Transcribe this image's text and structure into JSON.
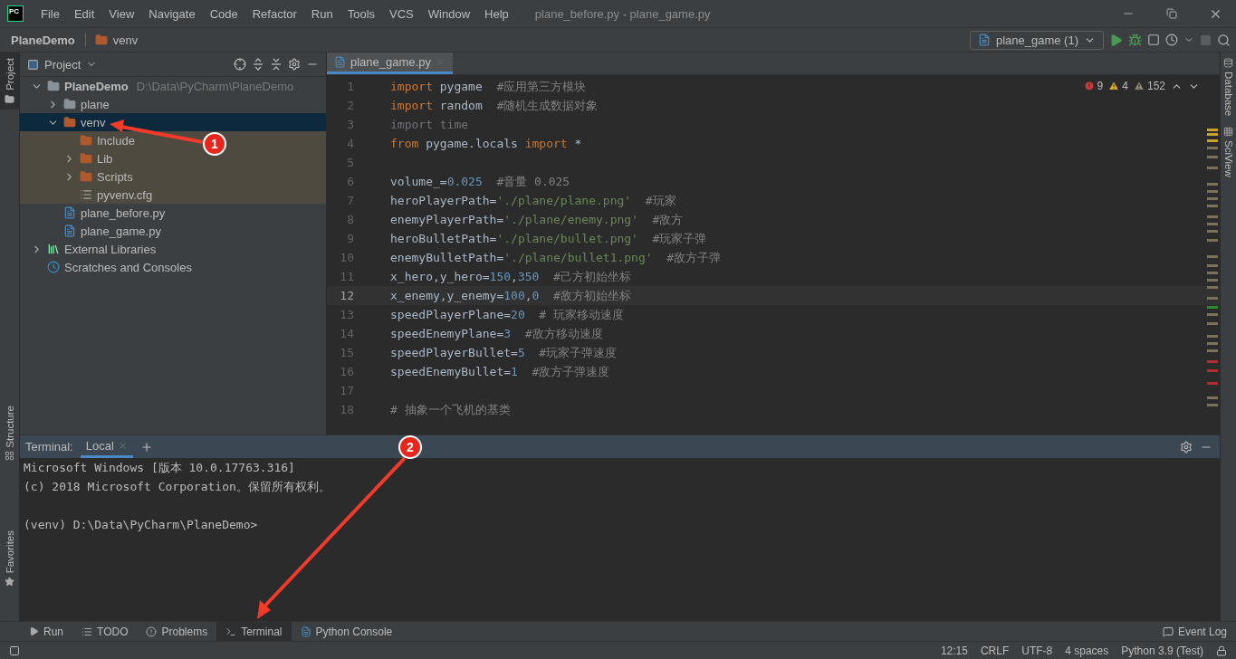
{
  "window": {
    "logo": "PC",
    "title": "plane_before.py - plane_game.py",
    "menus": [
      "File",
      "Edit",
      "View",
      "Navigate",
      "Code",
      "Refactor",
      "Run",
      "Tools",
      "VCS",
      "Window",
      "Help"
    ]
  },
  "breadcrumb": [
    {
      "label": "PlaneDemo",
      "kind": "project"
    },
    {
      "label": "venv",
      "kind": "folder"
    }
  ],
  "run_config": {
    "label": "plane_game (1)"
  },
  "left_stripe": [
    {
      "label": "Project",
      "selected": true,
      "kind": "project"
    },
    {
      "label": "Structure",
      "selected": false,
      "kind": "structure"
    },
    {
      "label": "Favorites",
      "selected": false,
      "kind": "favorites"
    }
  ],
  "right_stripe": [
    {
      "label": "Database",
      "kind": "database"
    },
    {
      "label": "SciView",
      "kind": "sciview"
    }
  ],
  "project_panel": {
    "title": "Project",
    "tree": [
      {
        "name": "PlaneDemo",
        "hint": "D:\\Data\\PyCharm\\PlaneDemo",
        "kind": "module",
        "expanded": true,
        "selected": false,
        "excluded": false,
        "children": [
          {
            "name": "plane",
            "kind": "folder",
            "expanded": false,
            "selected": false,
            "excluded": false
          },
          {
            "name": "venv",
            "kind": "excluded-folder",
            "expanded": true,
            "selected": true,
            "excluded": false,
            "children": [
              {
                "name": "Include",
                "kind": "excluded-folder",
                "selected": false,
                "excluded": true
              },
              {
                "name": "Lib",
                "kind": "excluded-folder",
                "expanded": false,
                "selected": false,
                "excluded": true
              },
              {
                "name": "Scripts",
                "kind": "excluded-folder",
                "expanded": false,
                "selected": false,
                "excluded": true
              },
              {
                "name": "pyvenv.cfg",
                "kind": "text-file",
                "selected": false,
                "excluded": true
              }
            ]
          },
          {
            "name": "plane_before.py",
            "kind": "python-file",
            "selected": false,
            "excluded": false
          },
          {
            "name": "plane_game.py",
            "kind": "python-file",
            "selected": false,
            "excluded": false
          }
        ]
      },
      {
        "name": "External Libraries",
        "kind": "libraries",
        "expanded": false,
        "selected": false,
        "excluded": false
      },
      {
        "name": "Scratches and Consoles",
        "kind": "scratches",
        "selected": false,
        "excluded": false
      }
    ]
  },
  "editor": {
    "tabs": [
      {
        "label": "plane_game.py",
        "selected": true
      }
    ],
    "inspections": {
      "errors": "9",
      "warnings": "4",
      "weak_warnings": "152"
    },
    "lines": [
      {
        "number": "1",
        "current": false,
        "tokens": [
          {
            "kind": "keyword",
            "text": "import"
          },
          {
            "kind": "plain",
            "text": " pygame  "
          },
          {
            "kind": "comment",
            "text": "#应用第三方模块"
          }
        ]
      },
      {
        "number": "2",
        "current": false,
        "tokens": [
          {
            "kind": "keyword",
            "text": "import"
          },
          {
            "kind": "plain",
            "text": " random  "
          },
          {
            "kind": "comment",
            "text": "#随机生成数据对象"
          }
        ]
      },
      {
        "number": "3",
        "current": false,
        "tokens": [
          {
            "kind": "unused",
            "text": "import time"
          }
        ]
      },
      {
        "number": "4",
        "current": false,
        "tokens": [
          {
            "kind": "keyword",
            "text": "from"
          },
          {
            "kind": "plain",
            "text": " pygame.locals "
          },
          {
            "kind": "keyword",
            "text": "import"
          },
          {
            "kind": "plain",
            "text": " *"
          }
        ]
      },
      {
        "number": "5",
        "current": false
      },
      {
        "number": "6",
        "current": false,
        "tokens": [
          {
            "kind": "plain",
            "text": "volume_="
          },
          {
            "kind": "number",
            "text": "0.025"
          },
          {
            "kind": "comment",
            "text": "#音量 0.025"
          }
        ]
      },
      {
        "number": "7",
        "current": false,
        "tokens": [
          {
            "kind": "plain",
            "text": "heroPlayerPath="
          },
          {
            "kind": "string",
            "text": "'./plane/plane.png'"
          },
          {
            "kind": "comment",
            "text": "#玩家"
          }
        ]
      },
      {
        "number": "8",
        "current": false,
        "tokens": [
          {
            "kind": "plain",
            "text": "enemyPlayerPath="
          },
          {
            "kind": "string",
            "text": "'./plane/enemy.png'"
          },
          {
            "kind": "comment",
            "text": "#敌方"
          }
        ]
      },
      {
        "number": "9",
        "current": false,
        "tokens": [
          {
            "kind": "plain",
            "text": "heroBulletPath="
          },
          {
            "kind": "string",
            "text": "'./plane/bullet.png'"
          },
          {
            "kind": "comment",
            "text": "#玩家子弹"
          }
        ]
      },
      {
        "number": "10",
        "current": false,
        "tokens": [
          {
            "kind": "plain",
            "text": "enemyBulletPath="
          },
          {
            "kind": "string",
            "text": "'./plane/bullet1.png'"
          },
          {
            "kind": "comment",
            "text": "#敌方子弹"
          }
        ]
      },
      {
        "number": "11",
        "current": false,
        "tokens": [
          {
            "kind": "plain",
            "text": "x_hero,y_hero="
          },
          {
            "kind": "number",
            "text": "150"
          },
          {
            "kind": "plain",
            "text": ","
          },
          {
            "kind": "number",
            "text": "350"
          },
          {
            "kind": "comment",
            "text": "#己方初始坐标"
          }
        ]
      },
      {
        "number": "12",
        "current": true,
        "tokens": [
          {
            "kind": "plain",
            "text": "x_enemy,y_enemy="
          },
          {
            "kind": "number",
            "text": "100"
          },
          {
            "kind": "plain",
            "text": ","
          },
          {
            "kind": "number",
            "text": "0"
          },
          {
            "kind": "comment",
            "text": "#敌方初始坐标"
          }
        ]
      },
      {
        "number": "13",
        "current": false,
        "tokens": [
          {
            "kind": "plain",
            "text": "speedPlayerPlane="
          },
          {
            "kind": "number",
            "text": "20"
          },
          {
            "kind": "comment",
            "text": "# 玩家移动速度"
          }
        ]
      },
      {
        "number": "14",
        "current": false,
        "tokens": [
          {
            "kind": "plain",
            "text": "speedEnemyPlane="
          },
          {
            "kind": "number",
            "text": "3"
          },
          {
            "kind": "comment",
            "text": "#敌方移动速度"
          }
        ]
      },
      {
        "number": "15",
        "current": false,
        "tokens": [
          {
            "kind": "plain",
            "text": "speedPlayerBullet="
          },
          {
            "kind": "number",
            "text": "5"
          },
          {
            "kind": "comment",
            "text": "#玩家子弹速度"
          }
        ]
      },
      {
        "number": "16",
        "current": false,
        "tokens": [
          {
            "kind": "plain",
            "text": "speedEnemyBullet="
          },
          {
            "kind": "number",
            "text": "1"
          },
          {
            "kind": "comment",
            "text": "#敌方子弹速度"
          }
        ]
      },
      {
        "number": "17",
        "current": false
      },
      {
        "number": "18",
        "current": false,
        "tokens": [
          {
            "kind": "comment",
            "text": "# 抽象一个飞机的基类"
          }
        ]
      }
    ]
  },
  "terminal": {
    "label": "Terminal:",
    "tabs": [
      {
        "label": "Local",
        "selected": true
      }
    ],
    "lines": [
      {
        "text": "Microsoft Windows [版本 10.0.17763.316]",
        "blank_before": false
      },
      {
        "text": "(c) 2018 Microsoft Corporation。保留所有权利。",
        "blank_before": false
      },
      {
        "text": "(venv) D:\\Data\\PyCharm\\PlaneDemo>",
        "blank_before": true
      }
    ]
  },
  "tool_tabs": [
    {
      "label": "Run",
      "kind": "run",
      "selected": false
    },
    {
      "label": "TODO",
      "kind": "todo",
      "selected": false
    },
    {
      "label": "Problems",
      "kind": "problems",
      "selected": false
    },
    {
      "label": "Terminal",
      "kind": "terminal",
      "selected": true
    },
    {
      "label": "Python Console",
      "kind": "console",
      "selected": false
    }
  ],
  "event_log": "Event Log",
  "status_bar": [
    "12:15",
    "CRLF",
    "UTF-8",
    "4 spaces",
    "Python 3.9 (Test)"
  ],
  "annotations": [
    {
      "label": "1",
      "kind": "tree"
    },
    {
      "label": "2",
      "kind": "tabs"
    }
  ]
}
